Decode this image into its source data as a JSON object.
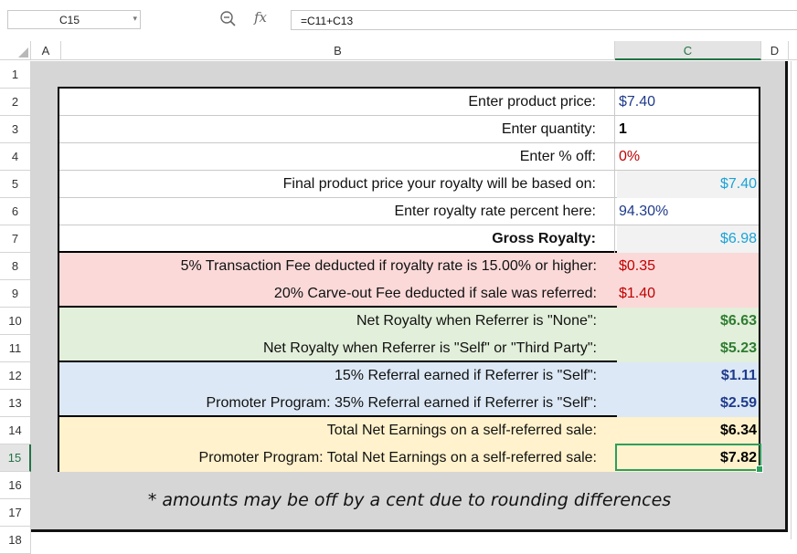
{
  "formula_bar": {
    "cell_ref": "C15",
    "dropdown_glyph": "▾",
    "fx_label": "fx",
    "formula": "=C11+C13"
  },
  "columns": [
    "A",
    "B",
    "C",
    "D"
  ],
  "rows": [
    "1",
    "2",
    "3",
    "4",
    "5",
    "6",
    "7",
    "8",
    "9",
    "10",
    "11",
    "12",
    "13",
    "14",
    "15",
    "16",
    "17",
    "18"
  ],
  "active_cell": {
    "column": "C",
    "row": "15"
  },
  "colors": {
    "blue": "#1f3b8c",
    "red": "#c00000",
    "teal": "#1aa3d6",
    "green": "#2e7d32",
    "black": "#000000",
    "pink_fill": "#fbd9d9",
    "green_fill": "#e2efda",
    "blue_fill": "#dce8f5",
    "yellow_fill": "#fff2cc",
    "gray_fill": "#f2f2f2"
  },
  "calculator": [
    {
      "label": "Enter product price:",
      "value": "$7.40",
      "color": "blue",
      "fill": "",
      "value_fill": "",
      "align": "left",
      "bold_label": false,
      "bold_value": false
    },
    {
      "label": "Enter quantity:",
      "value": "1",
      "color": "black",
      "fill": "",
      "value_fill": "",
      "align": "left",
      "bold_label": false,
      "bold_value": true
    },
    {
      "label": "Enter % off:",
      "value": "0%",
      "color": "red",
      "fill": "",
      "value_fill": "",
      "align": "left",
      "bold_label": false,
      "bold_value": false
    },
    {
      "label": "Final product price your royalty will be based on:",
      "value": "$7.40",
      "color": "teal",
      "fill": "",
      "value_fill": "gray_fill",
      "align": "right",
      "bold_label": false,
      "bold_value": false
    },
    {
      "label": "Enter royalty rate percent here:",
      "value": "94.30%",
      "color": "blue",
      "fill": "",
      "value_fill": "",
      "align": "left",
      "bold_label": false,
      "bold_value": false
    },
    {
      "label": "Gross Royalty:",
      "value": "$6.98",
      "color": "teal",
      "fill": "",
      "value_fill": "gray_fill",
      "align": "right",
      "bold_label": true,
      "bold_value": false
    },
    {
      "label": "5% Transaction Fee deducted if royalty rate is 15.00% or higher:",
      "value": "$0.35",
      "color": "red",
      "fill": "pink_fill",
      "value_fill": "pink_fill",
      "align": "left",
      "bold_label": false,
      "bold_value": false
    },
    {
      "label": "20% Carve-out Fee deducted if sale was referred:",
      "value": "$1.40",
      "color": "red",
      "fill": "pink_fill",
      "value_fill": "pink_fill",
      "align": "left",
      "bold_label": false,
      "bold_value": false
    },
    {
      "label": "Net Royalty when Referrer is \"None\":",
      "value": "$6.63",
      "color": "green",
      "fill": "green_fill",
      "value_fill": "green_fill",
      "align": "right",
      "bold_label": false,
      "bold_value": true
    },
    {
      "label": "Net Royalty when Referrer is \"Self\" or \"Third Party\":",
      "value": "$5.23",
      "color": "green",
      "fill": "green_fill",
      "value_fill": "green_fill",
      "align": "right",
      "bold_label": false,
      "bold_value": true
    },
    {
      "label": "15% Referral earned if Referrer is \"Self\":",
      "value": "$1.11",
      "color": "blue",
      "fill": "blue_fill",
      "value_fill": "blue_fill",
      "align": "right",
      "bold_label": false,
      "bold_value": true
    },
    {
      "label": "Promoter Program: 35% Referral earned if Referrer is \"Self\":",
      "value": "$2.59",
      "color": "blue",
      "fill": "blue_fill",
      "value_fill": "blue_fill",
      "align": "right",
      "bold_label": false,
      "bold_value": true
    },
    {
      "label": "Total Net Earnings on a self-referred sale:",
      "value": "$6.34",
      "color": "black",
      "fill": "yellow_fill",
      "value_fill": "yellow_fill",
      "align": "right",
      "bold_label": false,
      "bold_value": true
    },
    {
      "label": "Promoter Program: Total Net Earnings on a self-referred sale:",
      "value": "$7.82",
      "color": "black",
      "fill": "yellow_fill",
      "value_fill": "yellow_fill",
      "align": "right",
      "bold_label": false,
      "bold_value": true
    }
  ],
  "footnote": "* amounts may be off by a cent due to rounding differences"
}
